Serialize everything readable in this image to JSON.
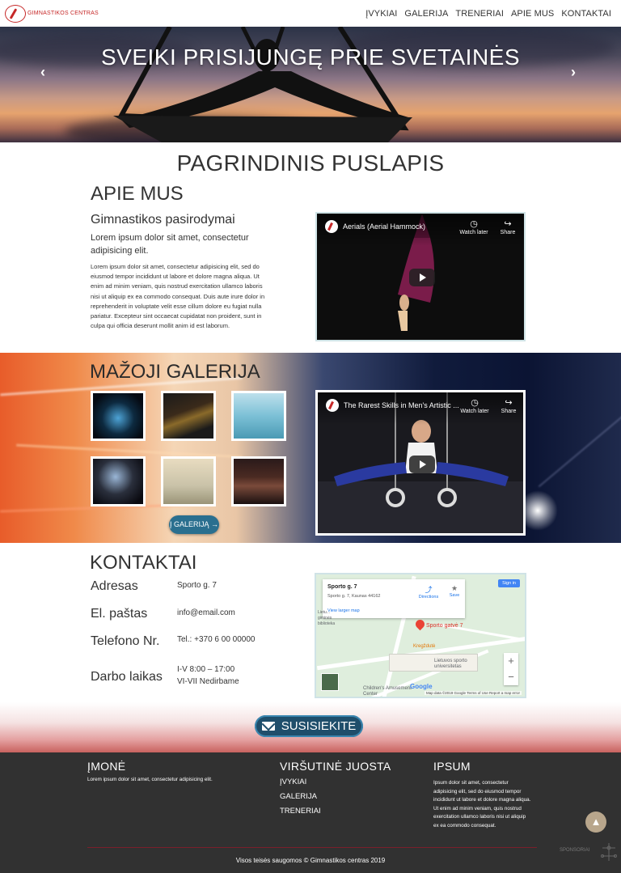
{
  "nav": {
    "logo_text": "GIMNASTIKOS CENTRAS",
    "items": [
      {
        "label": "ĮVYKIAI"
      },
      {
        "label": "GALERIJA"
      },
      {
        "label": "TRENERIAI"
      },
      {
        "label": "APIE MUS"
      },
      {
        "label": "KONTAKTAI"
      }
    ]
  },
  "hero": {
    "title": "SVEIKI PRISIJUNGĘ PRIE SVETAINĖS",
    "prev_icon": "‹",
    "next_icon": "›"
  },
  "main": {
    "page_title": "PAGRINDINIS PUSLAPIS",
    "about": {
      "title": "APIE MUS",
      "subtitle": "Gimnastikos pasirodymai",
      "lead": "Lorem ipsum dolor sit amet, consectetur adipisicing elit.",
      "body": "Lorem ipsum dolor sit amet, consectetur adipisicing elit, sed do eiusmod tempor incididunt ut labore et dolore magna aliqua. Ut enim ad minim veniam, quis nostrud exercitation ullamco laboris nisi ut aliquip ex ea commodo consequat. Duis aute irure dolor in reprehenderit in voluptate velit esse cillum dolore eu fugiat nulla pariatur. Excepteur sint occaecat cupidatat non proident, sunt in culpa qui officia deserunt mollit anim id est laborum.",
      "video": {
        "title": "Aerials (Aerial Hammock)",
        "watch_later": "Watch later",
        "share": "Share"
      }
    },
    "gallery": {
      "title": "MAŽOJI GALERIJA",
      "button": "Į GALERIJĄ →",
      "video": {
        "title": "The Rarest Skills in Men's Artistic ...",
        "watch_later": "Watch later",
        "share": "Share"
      }
    },
    "contacts": {
      "title": "KONTAKTAI",
      "rows": [
        {
          "label": "Adresas",
          "value": "Sporto g. 7"
        },
        {
          "label": "El. paštas",
          "value": "info@email.com"
        },
        {
          "label": "Telefono Nr.",
          "value": "Tel.: +370 6 00 00000"
        },
        {
          "label": "Darbo laikas",
          "value": "I-V 8:00 – 17:00",
          "value2": "VI-VII Nedirbame"
        }
      ],
      "map": {
        "card_title": "Sporto g. 7",
        "card_sub": "Sporto g. 7, Kaunas 44162",
        "larger": "View larger map",
        "directions": "Directions",
        "save": "Save",
        "sign_in": "Sign in",
        "pin_label": "Sporto gatvė 7",
        "poi_1": "Kregždutė",
        "poi_2": "Lietuvos sporto universitetas",
        "poi_3": "Children's Amusement Center",
        "poi_4": "Lietu... giminės biblioteka",
        "google": "Google",
        "footer": "Map data ©2019 Google   Terms of Use   Report a map error"
      }
    },
    "cta": {
      "label": "SUSISIEKITE"
    }
  },
  "footer": {
    "col1": {
      "title": "ĮMONĖ",
      "text": "Lorem ipsum dolor sit amet, consectetur adipisicing elit."
    },
    "col2": {
      "title": "VIRŠUTINĖ JUOSTA",
      "links": [
        {
          "label": "ĮVYKIAI"
        },
        {
          "label": "GALERIJA"
        },
        {
          "label": "TRENERIAI"
        }
      ]
    },
    "col3": {
      "title": "IPSUM",
      "text": "Ipsum dolor sit amet, consectetur adipisicing elit, sed do eiusmod tempor incididunt ut labore et dolore magna aliqua. Ut enim ad minim veniam, quis nostrud exercitation ullamco laboris nisi ut aliquip ex ea commodo consequat."
    },
    "copyright": "Visos teisės saugomos © Gimnastikos centras 2019",
    "sponsor": "SPONSORIAI",
    "to_top_icon": "▲"
  }
}
